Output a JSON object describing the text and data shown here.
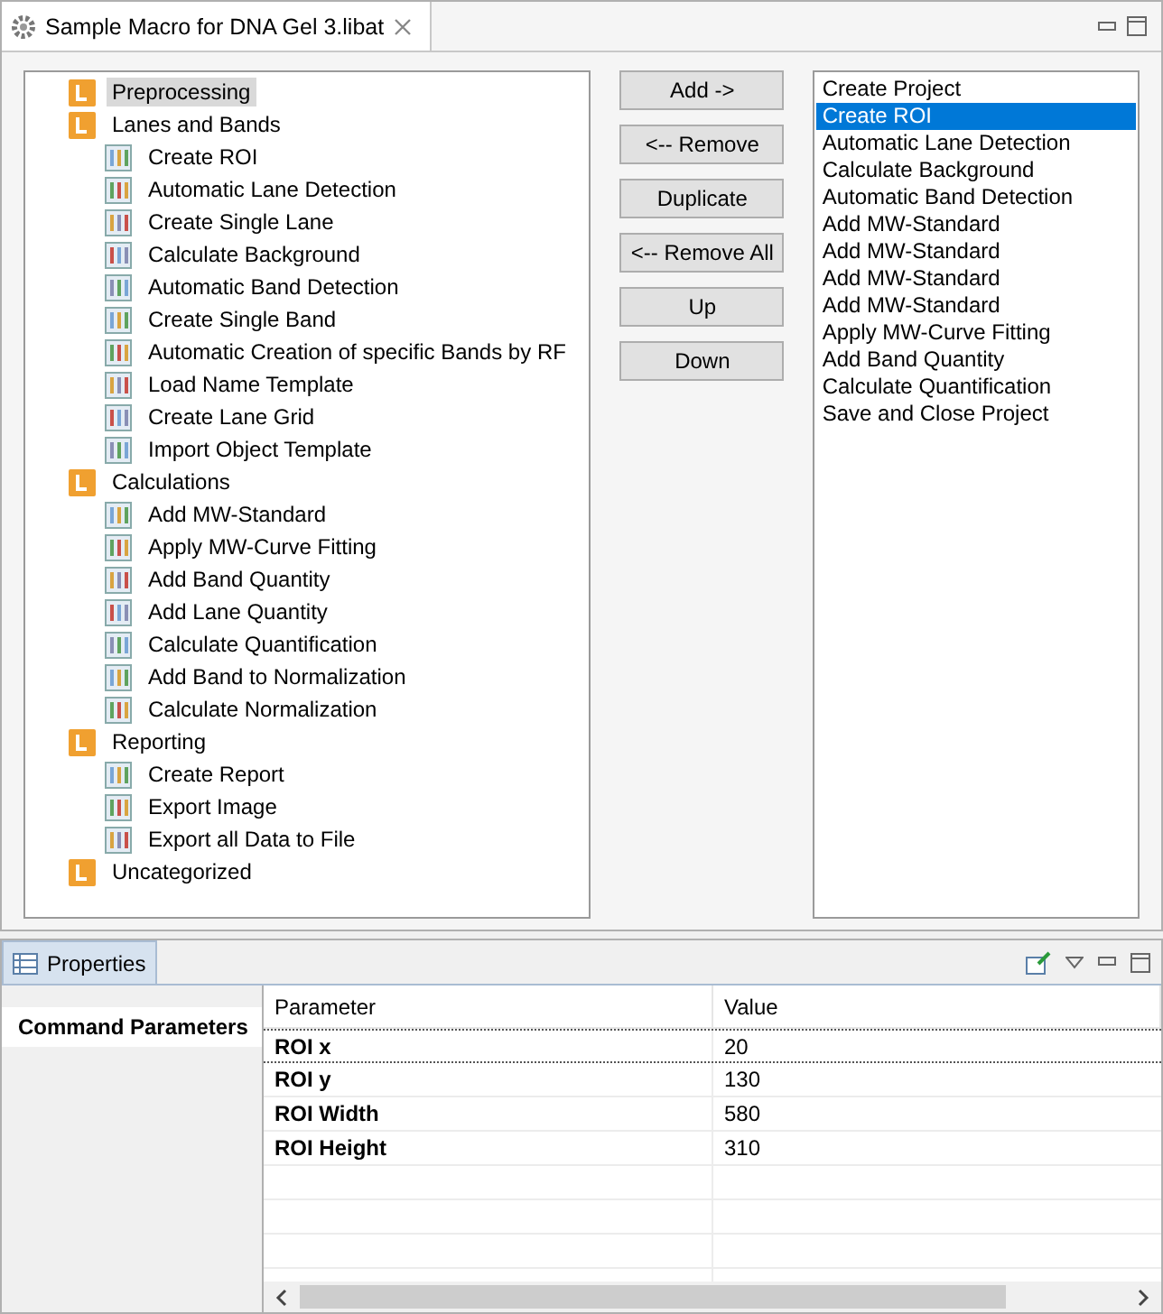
{
  "editor_tab": {
    "title": "Sample Macro for DNA Gel 3.libat"
  },
  "tree": [
    {
      "label": "Preprocessing",
      "selected": true
    },
    {
      "label": "Lanes and Bands",
      "selected": false,
      "children": [
        {
          "label": "Create ROI",
          "selected": false
        },
        {
          "label": "Automatic Lane Detection",
          "selected": false
        },
        {
          "label": "Create Single Lane",
          "selected": false
        },
        {
          "label": "Calculate Background",
          "selected": false
        },
        {
          "label": "Automatic Band Detection",
          "selected": false
        },
        {
          "label": "Create Single Band",
          "selected": false
        },
        {
          "label": "Automatic Creation of specific Bands by RF",
          "selected": false
        },
        {
          "label": "Load Name Template",
          "selected": false
        },
        {
          "label": "Create Lane Grid",
          "selected": false
        },
        {
          "label": "Import Object Template",
          "selected": false
        }
      ]
    },
    {
      "label": "Calculations",
      "selected": false,
      "children": [
        {
          "label": "Add MW-Standard",
          "selected": false
        },
        {
          "label": "Apply MW-Curve Fitting",
          "selected": false
        },
        {
          "label": "Add Band Quantity",
          "selected": false
        },
        {
          "label": "Add Lane Quantity",
          "selected": false
        },
        {
          "label": "Calculate Quantification",
          "selected": false
        },
        {
          "label": "Add Band to Normalization",
          "selected": false
        },
        {
          "label": "Calculate Normalization",
          "selected": false
        }
      ]
    },
    {
      "label": "Reporting",
      "selected": false,
      "children": [
        {
          "label": "Create Report",
          "selected": false
        },
        {
          "label": "Export Image",
          "selected": false
        },
        {
          "label": "Export all Data to File",
          "selected": false
        }
      ]
    },
    {
      "label": "Uncategorized",
      "selected": false
    }
  ],
  "buttons": [
    "Add ->",
    "<-- Remove",
    "Duplicate",
    "<-- Remove All",
    "Up",
    "Down"
  ],
  "macro_steps": [
    {
      "label": "Create Project",
      "selected": false
    },
    {
      "label": "Create ROI",
      "selected": true
    },
    {
      "label": "Automatic Lane Detection",
      "selected": false
    },
    {
      "label": "Calculate Background",
      "selected": false
    },
    {
      "label": "Automatic Band Detection",
      "selected": false
    },
    {
      "label": "Add MW-Standard",
      "selected": false
    },
    {
      "label": "Add MW-Standard",
      "selected": false
    },
    {
      "label": "Add MW-Standard",
      "selected": false
    },
    {
      "label": "Add MW-Standard",
      "selected": false
    },
    {
      "label": "Apply MW-Curve Fitting",
      "selected": false
    },
    {
      "label": "Add Band Quantity",
      "selected": false
    },
    {
      "label": "Calculate Quantification",
      "selected": false
    },
    {
      "label": "Save and Close Project",
      "selected": false
    }
  ],
  "properties": {
    "tab": "Properties",
    "side_tabs": [
      {
        "label": "Command Parameters",
        "selected": true
      }
    ],
    "columns": [
      "Parameter",
      "Value"
    ],
    "rows": [
      {
        "parameter": "ROI x",
        "value": "20",
        "selected": true
      },
      {
        "parameter": "ROI y",
        "value": "130",
        "selected": false
      },
      {
        "parameter": "ROI Width",
        "value": "580",
        "selected": false
      },
      {
        "parameter": "ROI Height",
        "value": "310",
        "selected": false
      }
    ]
  }
}
